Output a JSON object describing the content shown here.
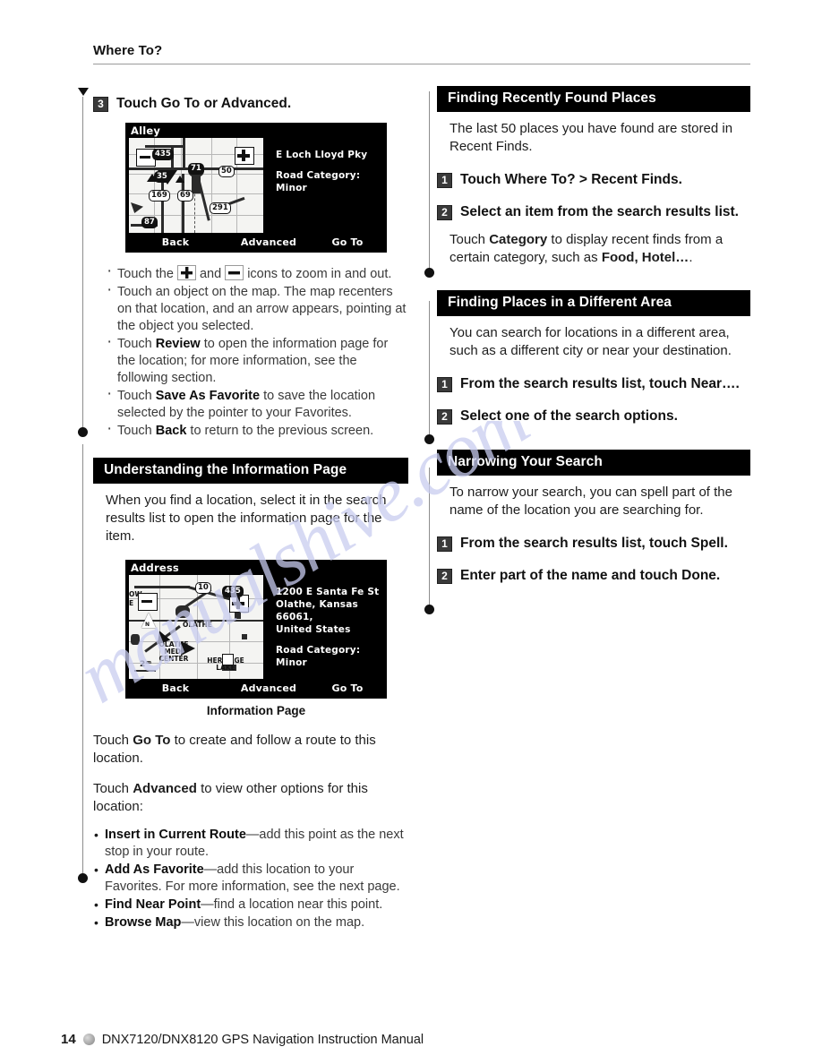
{
  "header": {
    "running_head": "Where To?"
  },
  "watermark": {
    "text": "manualshive.com"
  },
  "left_column": {
    "step3": {
      "number": "3",
      "text": "Touch Go To or Advanced."
    },
    "map1": {
      "title": "Alley",
      "info_line1": "E Loch Lloyd Pky",
      "info_line2": "Road Category: Minor",
      "btn_back": "Back",
      "btn_advanced": "Advanced",
      "btn_goto": "Go To",
      "map_labels": [
        "435",
        "35",
        "169",
        "69",
        "50",
        "291",
        "71",
        "87"
      ]
    },
    "bullets1": [
      "Touch the  +  and  −  icons to zoom in and out.",
      "Touch an object on the map. The map recenters on that location, and an arrow appears, pointing at the object you selected.",
      "Touch Review to open the information page for the location; for more information, see the following section.",
      "Touch Save As Favorite to save the location selected by the pointer to your Favorites.",
      "Touch Back to return to the previous screen."
    ],
    "section_heading": "Understanding the Information Page",
    "section_body": "When you find a location, select it in the search results list to open the information page for the item.",
    "map2": {
      "title": "Address",
      "info_line1": "1200 E Santa Fe St",
      "info_line2": "Olathe, Kansas 66061,",
      "info_line3": "United States",
      "info_line4": "Road Category: Minor",
      "btn_back": "Back",
      "btn_advanced": "Advanced",
      "btn_goto": "Go To",
      "map_labels": [
        "10",
        "435",
        "OLATHE",
        "OLATHE MEDICAL CENTER",
        "HERITAGE LAKE",
        "2ᵐ",
        "OW",
        "E",
        "N"
      ]
    },
    "map2_caption": "Information Page",
    "para_goto": "Touch Go To to create and follow a route to this location.",
    "para_advanced": "Touch Advanced to view other options for this location:",
    "bullets2": [
      "Insert in Current Route—add this point as the next stop in your route.",
      "Add As Favorite—add this location to your Favorites. For more information, see the next page.",
      "Find Near Point—find a location near this point.",
      "Browse Map—view this location on the map."
    ]
  },
  "right_column": {
    "section1": {
      "heading": "Finding Recently Found Places",
      "body": "The last 50 places you have found are stored in Recent Finds.",
      "steps": [
        {
          "number": "1",
          "text": "Touch Where To? > Recent Finds."
        },
        {
          "number": "2",
          "text": "Select an item from the search results list."
        }
      ],
      "footnote": "Touch Category to display recent finds from a certain category, such as Food, Hotel…."
    },
    "section2": {
      "heading": "Finding Places in a Different Area",
      "body": "You can search for locations in a different area, such as a different city or near your destination.",
      "steps": [
        {
          "number": "1",
          "text": "From the search results list, touch Near…."
        },
        {
          "number": "2",
          "text": "Select one of the search options."
        }
      ]
    },
    "section3": {
      "heading": "Narrowing Your Search",
      "body": "To narrow your search, you can spell part of the name of the location you are searching for.",
      "steps": [
        {
          "number": "1",
          "text": "From the search results list, touch Spell."
        },
        {
          "number": "2",
          "text": "Enter part of the name and touch Done."
        }
      ]
    }
  },
  "footer": {
    "page_number": "14",
    "title": "DNX7120/DNX8120 GPS Navigation Instruction Manual"
  }
}
